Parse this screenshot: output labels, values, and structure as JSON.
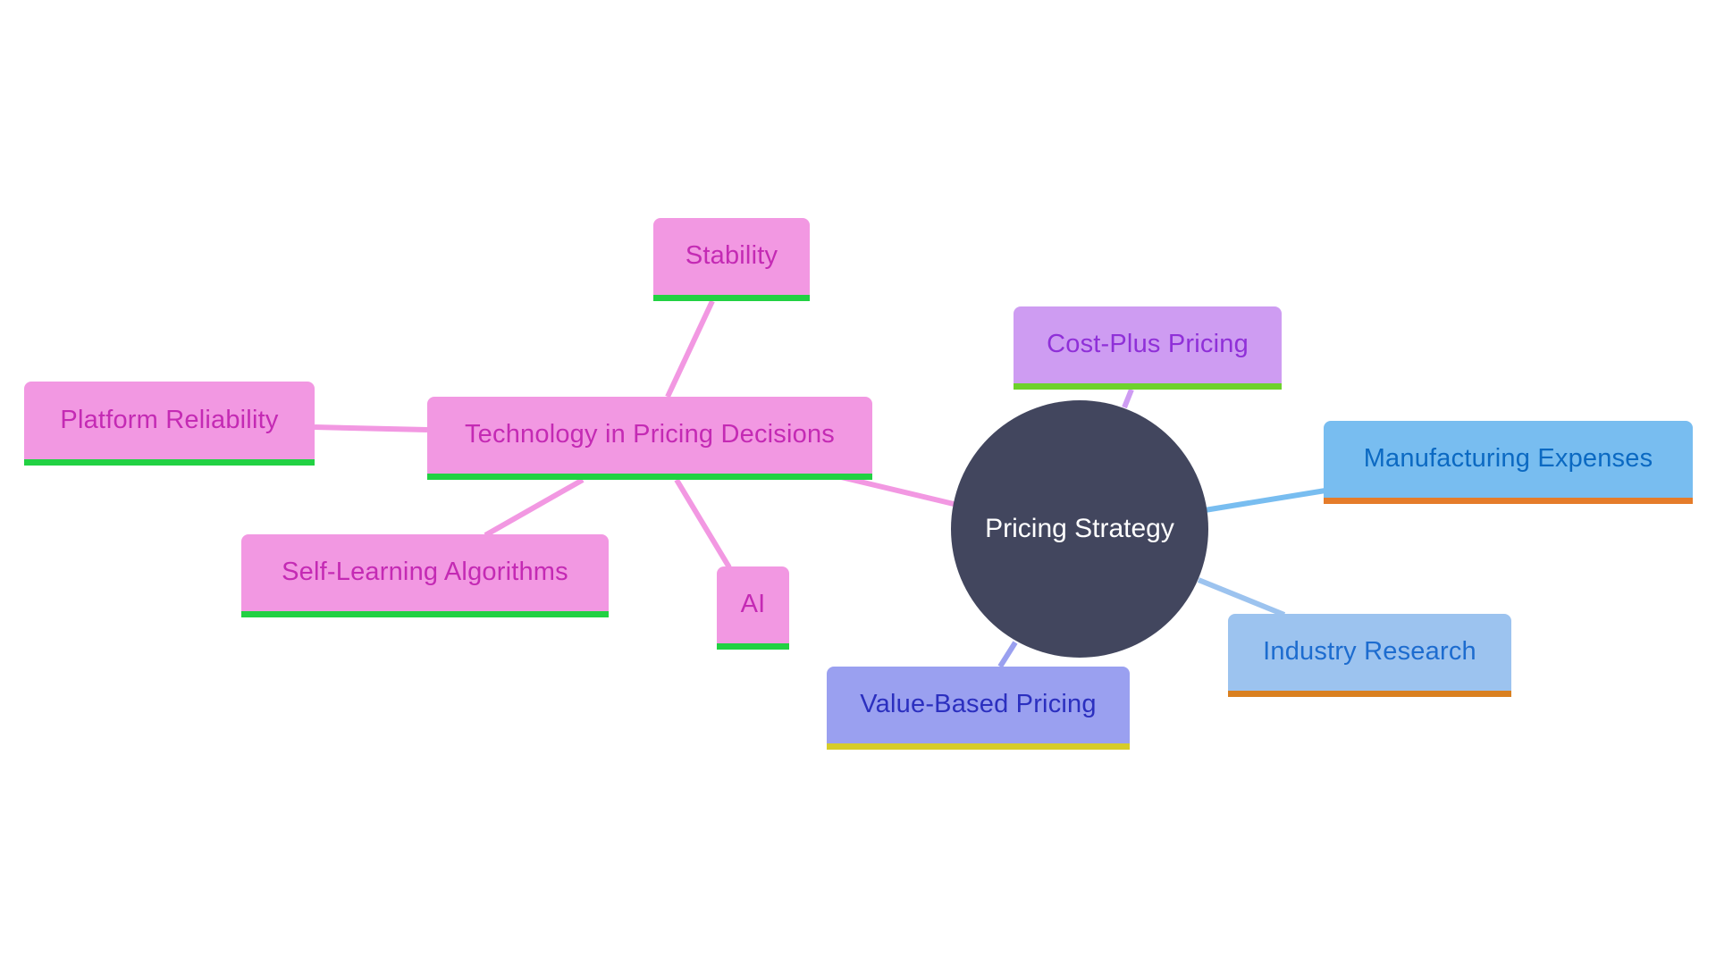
{
  "diagram": {
    "type": "mindmap",
    "root": {
      "id": "root",
      "label": "Pricing Strategy",
      "color": "#42465e",
      "text_color": "#ffffff"
    },
    "nodes": [
      {
        "id": "tech",
        "label": "Technology in Pricing Decisions",
        "parent": "root",
        "theme": "pink"
      },
      {
        "id": "stability",
        "label": "Stability",
        "parent": "tech",
        "theme": "pink"
      },
      {
        "id": "platform",
        "label": "Platform Reliability",
        "parent": "tech",
        "theme": "pink"
      },
      {
        "id": "selflearning",
        "label": "Self-Learning Algorithms",
        "parent": "tech",
        "theme": "pink"
      },
      {
        "id": "ai",
        "label": "AI",
        "parent": "tech",
        "theme": "pink"
      },
      {
        "id": "costplus",
        "label": "Cost-Plus Pricing",
        "parent": "root",
        "theme": "purple"
      },
      {
        "id": "mfg",
        "label": "Manufacturing Expenses",
        "parent": "root",
        "theme": "sky"
      },
      {
        "id": "industry",
        "label": "Industry Research",
        "parent": "root",
        "theme": "lightblue"
      },
      {
        "id": "valuebased",
        "label": "Value-Based Pricing",
        "parent": "root",
        "theme": "lavender"
      }
    ],
    "edges": [
      {
        "from": "root",
        "to": "tech",
        "color": "#f298e2"
      },
      {
        "from": "tech",
        "to": "stability",
        "color": "#f298e2"
      },
      {
        "from": "tech",
        "to": "platform",
        "color": "#f298e2"
      },
      {
        "from": "tech",
        "to": "selflearning",
        "color": "#f298e2"
      },
      {
        "from": "tech",
        "to": "ai",
        "color": "#f298e2"
      },
      {
        "from": "root",
        "to": "costplus",
        "color": "#ce9cf2"
      },
      {
        "from": "root",
        "to": "mfg",
        "color": "#78bdf0"
      },
      {
        "from": "root",
        "to": "industry",
        "color": "#9cc3ef"
      },
      {
        "from": "root",
        "to": "valuebased",
        "color": "#9aa0f0"
      }
    ],
    "themes": {
      "pink": {
        "fill": "#f298e2",
        "text": "#c42ab4",
        "underline": "#22d143"
      },
      "purple": {
        "fill": "#ce9cf2",
        "text": "#8f30d8",
        "underline": "#6ed12c"
      },
      "sky": {
        "fill": "#78bdf0",
        "text": "#0b69c2",
        "underline": "#e57c2a"
      },
      "lightblue": {
        "fill": "#9cc3ef",
        "text": "#1d6ccf",
        "underline": "#d98020"
      },
      "lavender": {
        "fill": "#9aa0f0",
        "text": "#2b2fbf",
        "underline": "#d6cc2a"
      }
    }
  }
}
